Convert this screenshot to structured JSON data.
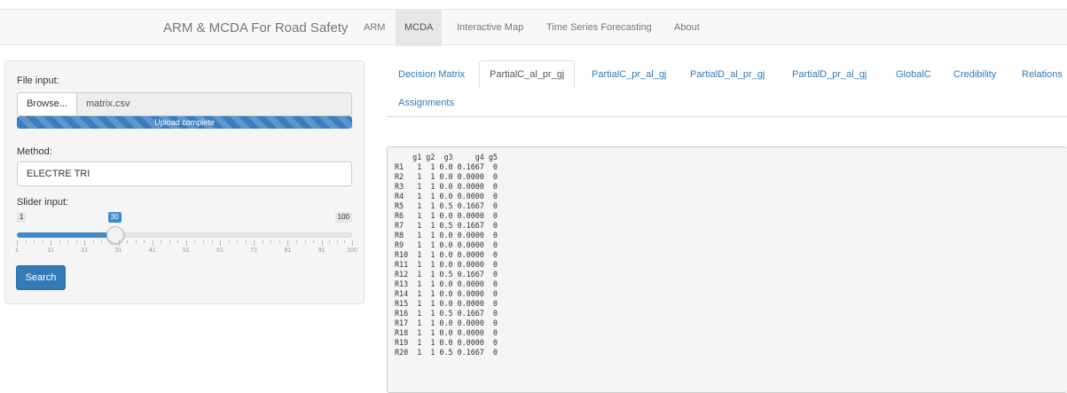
{
  "navbar": {
    "brand": "ARM & MCDA For Road Safety",
    "items": [
      {
        "label": "ARM",
        "active": false
      },
      {
        "label": "MCDA",
        "active": true
      },
      {
        "label": "Interactive Map",
        "active": false
      },
      {
        "label": "Time Series Forecasting",
        "active": false
      },
      {
        "label": "About",
        "active": false
      }
    ]
  },
  "sidebar": {
    "file_input_label": "File input:",
    "browse_label": "Browse...",
    "file_name": "matrix.csv",
    "upload_status": "Upload complete",
    "upload_progress": 1.0,
    "method_label": "Method:",
    "method_value": "ELECTRE TRI",
    "slider_label": "Slider input:",
    "slider_min": "1",
    "slider_max": "100",
    "slider_value": "30",
    "slider_ticks": [
      "1",
      "11",
      "21",
      "31",
      "41",
      "51",
      "61",
      "71",
      "81",
      "91",
      "100"
    ],
    "search_label": "Search"
  },
  "tabs": [
    {
      "label": "Decision Matrix",
      "active": false
    },
    {
      "label": "PartialC_al_pr_gj",
      "active": true
    },
    {
      "label": "PartialC_pr_al_gj",
      "active": false
    },
    {
      "label": "PartialD_al_pr_gj",
      "active": false
    },
    {
      "label": "PartialD_pr_al_gj",
      "active": false
    },
    {
      "label": "GlobalC",
      "active": false
    },
    {
      "label": "Credibility",
      "active": false
    },
    {
      "label": "Relations",
      "active": false
    },
    {
      "label": "Assignments",
      "active": false
    }
  ],
  "output": {
    "header": "    g1 g2  g3     g4 g5",
    "rows": [
      "R1   1  1 0.0 0.1667  0",
      "R2   1  1 0.0 0.0000  0",
      "R3   1  1 0.0 0.0000  0",
      "R4   1  1 0.0 0.0000  0",
      "R5   1  1 0.5 0.1667  0",
      "R6   1  1 0.0 0.0000  0",
      "R7   1  1 0.5 0.1667  0",
      "R8   1  1 0.0 0.0000  0",
      "R9   1  1 0.0 0.0000  0",
      "R10  1  1 0.0 0.0000  0",
      "R11  1  1 0.0 0.0000  0",
      "R12  1  1 0.5 0.1667  0",
      "R13  1  1 0.0 0.0000  0",
      "R14  1  1 0.0 0.0000  0",
      "R15  1  1 0.0 0.0000  0",
      "R16  1  1 0.5 0.1667  0",
      "R17  1  1 0.0 0.0000  0",
      "R18  1  1 0.0 0.0000  0",
      "R19  1  1 0.0 0.0000  0",
      "R20  1  1 0.5 0.1667  0"
    ]
  },
  "colors": {
    "accent": "#337ab7",
    "navbar_bg": "#f8f8f8",
    "well_bg": "#f5f5f5"
  }
}
